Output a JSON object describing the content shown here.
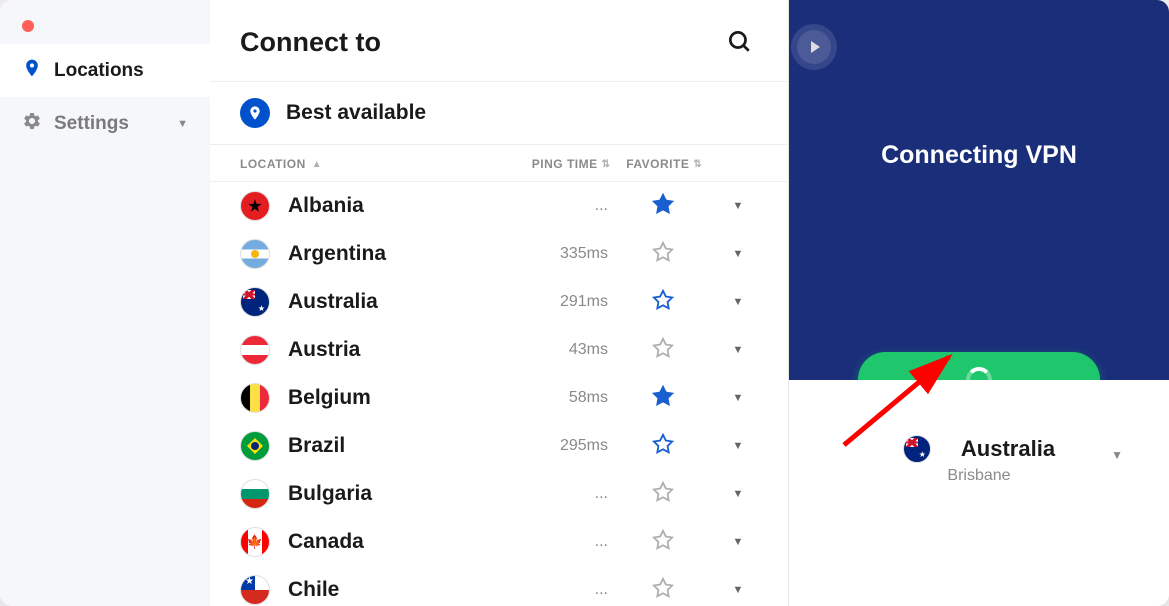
{
  "sidebar": {
    "items": [
      {
        "label": "Locations",
        "active": true
      },
      {
        "label": "Settings",
        "active": false
      }
    ]
  },
  "header": {
    "title": "Connect to"
  },
  "best": {
    "label": "Best available"
  },
  "columns": {
    "location": "LOCATION",
    "ping": "PING TIME",
    "favorite": "FAVORITE"
  },
  "locations": [
    {
      "name": "Albania",
      "ping": "...",
      "fav": true,
      "flag": "al"
    },
    {
      "name": "Argentina",
      "ping": "335ms",
      "fav": false,
      "flag": "ar"
    },
    {
      "name": "Australia",
      "ping": "291ms",
      "fav": false,
      "flag": "au",
      "favOutlineBlue": true
    },
    {
      "name": "Austria",
      "ping": "43ms",
      "fav": false,
      "flag": "at"
    },
    {
      "name": "Belgium",
      "ping": "58ms",
      "fav": true,
      "flag": "be"
    },
    {
      "name": "Brazil",
      "ping": "295ms",
      "fav": false,
      "flag": "br",
      "favOutlineBlue": true
    },
    {
      "name": "Bulgaria",
      "ping": "...",
      "fav": false,
      "flag": "bg"
    },
    {
      "name": "Canada",
      "ping": "...",
      "fav": false,
      "flag": "ca"
    },
    {
      "name": "Chile",
      "ping": "...",
      "fav": false,
      "flag": "cl"
    }
  ],
  "status": {
    "text": "Connecting VPN"
  },
  "selected": {
    "name": "Australia",
    "city": "Brisbane",
    "flag": "au"
  },
  "colors": {
    "accent": "#0052cc",
    "navy": "#1a2e7a",
    "green": "#1ec76b"
  }
}
